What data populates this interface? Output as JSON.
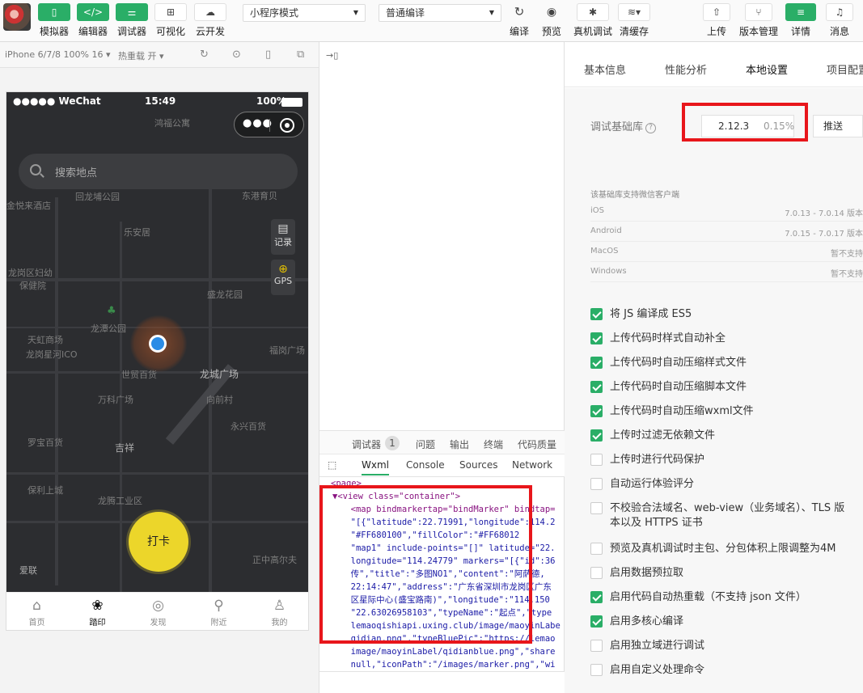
{
  "toolbar": {
    "simulator": "模拟器",
    "editor": "编辑器",
    "debugger": "调试器",
    "visual": "可视化",
    "cloud": "云开发",
    "mode_select": "小程序模式",
    "compile_select": "普通编译",
    "compile": "编译",
    "preview": "预览",
    "realdevice": "真机调试",
    "clearcache": "清缓存",
    "upload": "上传",
    "version": "版本管理",
    "details": "详情",
    "messages": "消息"
  },
  "simbar": {
    "device": "iPhone 6/7/8 100% 16 ▾",
    "hotreload": "热重载 开 ▾"
  },
  "phone": {
    "status_signal": "●●●●● WeChat",
    "status_time": "15:49",
    "status_battery": "100%",
    "search_placeholder": "搜索地点",
    "btn_record": "记录",
    "btn_gps": "GPS",
    "punch": "打卡",
    "map_labels": {
      "l1": "鸿福公寓",
      "l2": "回龙埔公园",
      "l3": "金悦来酒店",
      "l4": "东港育贝",
      "l5": "乐安居",
      "l6": "龙岗区妇幼",
      "l7": "保健院",
      "l8": "盛龙花园",
      "l9": "龙潭公园",
      "l10": "天虹商场",
      "l11": "龙岗星河ICO",
      "l12": "世贸百货",
      "l13": "龙城广场",
      "l14": "万科广场",
      "l15": "向前村",
      "l16": "永兴百货",
      "l17": "吉祥",
      "l18": "罗宝百货",
      "l19": "保利上城",
      "l20": "龙腾工业区",
      "l21": "爱联",
      "l22": "正中高尔夫",
      "l23": "福岗广场"
    },
    "tabs": {
      "home": "首页",
      "footprint": "踏印",
      "discover": "发现",
      "nearby": "附近",
      "mine": "我的"
    }
  },
  "debug": {
    "tab_debugger": "调试器",
    "badge": "1",
    "tab_issues": "问题",
    "tab_output": "输出",
    "tab_terminal": "终端",
    "tab_quality": "代码质量",
    "panel_wxml": "Wxml",
    "panel_console": "Console",
    "panel_sources": "Sources",
    "panel_network": "Network",
    "code": {
      "l0": "<page>",
      "l1": "▼<view class=\"container\">",
      "l2": "  <map bindmarkertap=\"bindMarker\" bindtap=",
      "l3": "  \"[{\"latitude\":22.71991,\"longitude\":114.2",
      "l4": "  \"#FF680100\",\"fillColor\":\"#FF68012",
      "l5": "  \"map1\" include-points=\"[]\" latitude=\"22.",
      "l6": "  longitude=\"114.24779\" markers=\"[{\"id\":36",
      "l7": "  传\",\"title\":\"多图NO1\",\"content\":\"阿萨德,",
      "l8": "  22:14:47\",\"address\":\"广东省深圳市龙岗区广东",
      "l9": "  区星际中心(盛宝路南)\",\"longitude\":\"114.150",
      "l10": "  \"22.63026958103\",\"typeName\":\"起点\",\"type",
      "l11": "  lemaoqishiapi.uxing.club/image/maoyinLabe",
      "l12": "  qidian.png\",\"typeBluePic\":\"https://lemao",
      "l13": "  image/maoyinLabel/qidianblue.png\",\"share",
      "l14": "  null,\"iconPath\":\"/images/marker.png\",\"wi"
    }
  },
  "right": {
    "tab_basic": "基本信息",
    "tab_perf": "性能分析",
    "tab_local": "本地设置",
    "tab_project": "项目配置",
    "lib_label": "调试基础库",
    "lib_version": "2.12.3",
    "lib_pct": "0.15%",
    "push": "推送",
    "client_hdr": "该基础库支持微信客户端",
    "clients": {
      "ios_n": "iOS",
      "ios_s": "7.0.13 - 7.0.14 版本",
      "android_n": "Android",
      "android_s": "7.0.15 - 7.0.17 版本",
      "mac_n": "MacOS",
      "mac_s": "暂不支持",
      "win_n": "Windows",
      "win_s": "暂不支持"
    },
    "options": {
      "o1": "将 JS 编译成 ES5",
      "o2": "上传代码时样式自动补全",
      "o3": "上传代码时自动压缩样式文件",
      "o4": "上传代码时自动压缩脚本文件",
      "o5": "上传代码时自动压缩wxml文件",
      "o6": "上传时过滤无依赖文件",
      "o7": "上传时进行代码保护",
      "o8": "自动运行体验评分",
      "o9": "不校验合法域名、web-view（业务域名）、TLS 版本以及 HTTPS 证书",
      "o10": "预览及真机调试时主包、分包体积上限调整为4M",
      "o11": "启用数据预拉取",
      "o12": "启用代码自动热重载（不支持 json 文件）",
      "o13": "启用多核心编译",
      "o14": "启用独立域进行调试",
      "o15": "启用自定义处理命令"
    },
    "checked": [
      true,
      true,
      true,
      true,
      true,
      true,
      false,
      false,
      false,
      false,
      false,
      true,
      true,
      false,
      false
    ]
  },
  "colors": {
    "green": "#2aae67",
    "highlight": "#e8161b",
    "map_bg": "#2c2d30",
    "punch": "#ecd62a",
    "location": "#2b8ce6"
  }
}
